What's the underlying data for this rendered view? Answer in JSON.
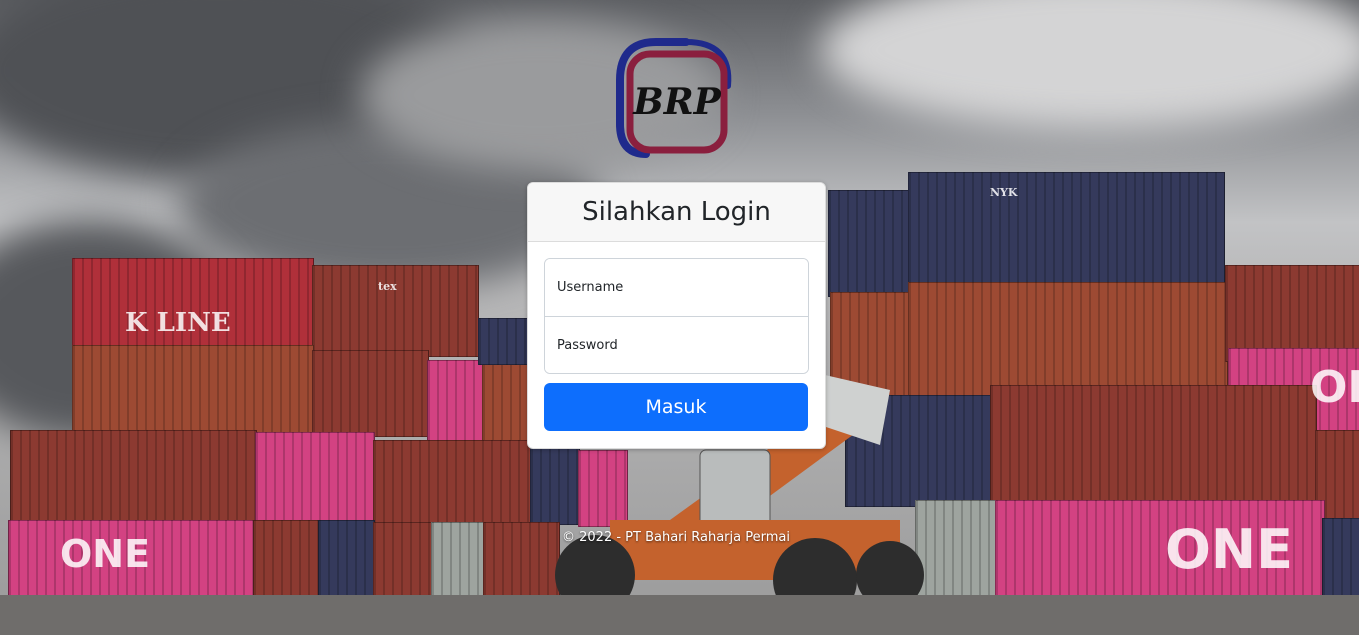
{
  "logo": {
    "text": "BRP"
  },
  "login": {
    "title": "Silahkan Login",
    "username_placeholder": "Username",
    "password_placeholder": "Password",
    "submit_label": "Masuk"
  },
  "footer": {
    "text": "© 2022 - PT Bahari Raharja Permai"
  },
  "background": {
    "container_labels": [
      "K LINE",
      "ONE",
      "ONE",
      "ONE",
      "tex",
      "NYK"
    ]
  },
  "colors": {
    "primary_button": "#0d6efd",
    "card_header_bg": "#f7f7f7",
    "logo_blue": "#1f2a8c",
    "logo_maroon": "#8a1f3e"
  }
}
